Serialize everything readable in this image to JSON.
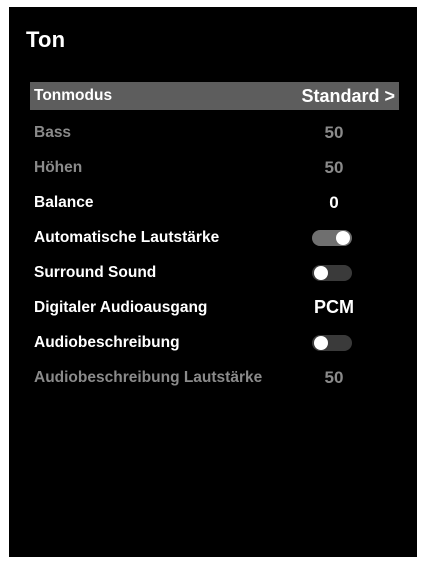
{
  "title": "Ton",
  "colors": {
    "background": "#000000",
    "selected_row": "#5d5d5d",
    "disabled_text": "#8a8a8a",
    "toggle_on": "#6f6f6f",
    "toggle_off": "#3a3a3a"
  },
  "menu": [
    {
      "label": "Tonmodus",
      "value": "Standard >"
    },
    {
      "label": "Bass",
      "value": "50"
    },
    {
      "label": "Höhen",
      "value": "50"
    },
    {
      "label": "Balance",
      "value": "0"
    },
    {
      "label": "Automatische Lautstärke",
      "toggle": "on"
    },
    {
      "label": "Surround Sound",
      "toggle": "off"
    },
    {
      "label": "Digitaler Audioausgang",
      "value": "PCM"
    },
    {
      "label": "Audiobeschreibung",
      "toggle": "off"
    },
    {
      "label": "Audiobeschreibung Lautstärke",
      "value": "50"
    }
  ]
}
